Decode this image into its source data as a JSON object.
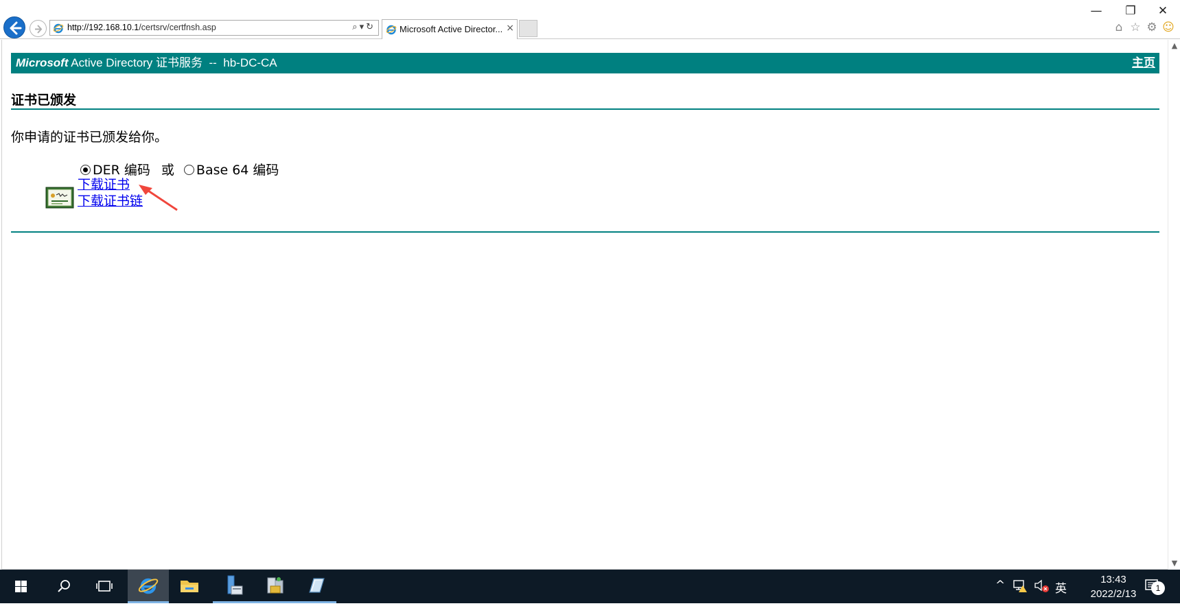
{
  "browser": {
    "address_url_host": "http://192.168.10.1",
    "address_url_path": "/certsrv/certfnsh.asp",
    "tab_title": "Microsoft Active Director...",
    "tab_close": "×",
    "window_controls": {
      "minimize": "—",
      "restore": "❐",
      "close": "✕"
    },
    "address_tools": "⌕▾↻",
    "right_tools": {
      "home": "⌂",
      "favorites": "☆",
      "settings": "⚙",
      "feedback": "☺"
    }
  },
  "page": {
    "banner": {
      "brand": "Microsoft",
      "title": " Active Directory 证书服务  --  hb-DC-CA",
      "home_link": "主页"
    },
    "heading": "证书已颁发",
    "message": "你申请的证书已颁发给你。",
    "encoding": {
      "option1": "DER 编码",
      "connector": "或",
      "option2": "Base 64 编码",
      "selected": "DER 编码"
    },
    "links": {
      "download_cert": "下载证书",
      "download_chain": "下载证书链"
    },
    "colors": {
      "banner": "#008080",
      "link": "#0000ee",
      "annotation_arrow": "#f0463c"
    }
  },
  "taskbar": {
    "time": "13:43",
    "date": "2022/2/13",
    "input_method": "英",
    "notification_count": "1",
    "pinned": [
      "start-icon",
      "search-icon",
      "task-view-icon",
      "internet-explorer-icon",
      "file-explorer-icon",
      "server-manager-icon",
      "certificate-authority-icon",
      "powershell-icon"
    ]
  }
}
